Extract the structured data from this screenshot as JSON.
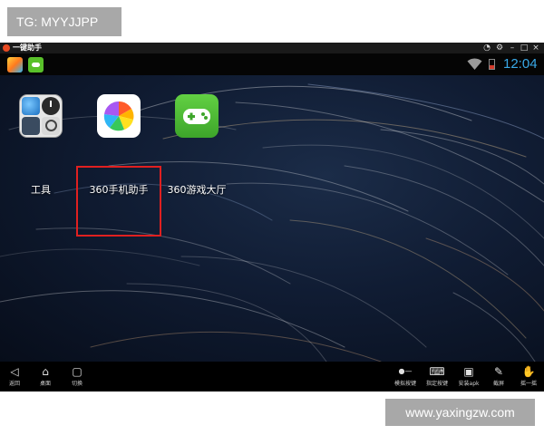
{
  "watermarks": {
    "top": "TG: MYYJJPP",
    "bottom": "www.yaxingzw.com"
  },
  "window": {
    "title": "一键助手",
    "title_icon": "app-logo-icon"
  },
  "titlebar_controls": [
    {
      "name": "help-icon",
      "glyph": "◔"
    },
    {
      "name": "settings-gear-icon",
      "glyph": "⚙"
    },
    {
      "name": "minimize-icon",
      "glyph": "–"
    },
    {
      "name": "maximize-icon",
      "glyph": "□"
    },
    {
      "name": "close-icon",
      "glyph": "×"
    }
  ],
  "statusbar": {
    "notification_icons": [
      "360-assistant-icon",
      "game-center-icon"
    ],
    "time": "12:04",
    "wifi_icon": "wifi-icon",
    "battery_icon": "battery-low-icon",
    "time_color": "#39a9e8"
  },
  "desktop_apps": [
    {
      "label": "工具",
      "icon": "tools-folder-icon"
    },
    {
      "label": "360手机助手",
      "icon": "360-mobile-assistant-icon",
      "highlighted": true
    },
    {
      "label": "360游戏大厅",
      "icon": "360-game-hall-icon"
    }
  ],
  "highlight_color": "#e02020",
  "navbar": {
    "left": [
      {
        "label": "返回",
        "icon": "back-icon",
        "glyph": "◁"
      },
      {
        "label": "桌面",
        "icon": "home-icon",
        "glyph": "⌂"
      },
      {
        "label": "切换",
        "icon": "recent-apps-icon",
        "glyph": "▢"
      }
    ],
    "right": [
      {
        "label": "模拟按键",
        "icon": "toggle-icon",
        "glyph": "●—"
      },
      {
        "label": "指定按键",
        "icon": "keyboard-icon",
        "glyph": "⌨"
      },
      {
        "label": "安装apk",
        "icon": "apk-install-icon",
        "glyph": "▣"
      },
      {
        "label": "截屏",
        "icon": "screenshot-icon",
        "glyph": "✎"
      },
      {
        "label": "摇一摇",
        "icon": "shake-icon",
        "glyph": "✋"
      }
    ]
  }
}
